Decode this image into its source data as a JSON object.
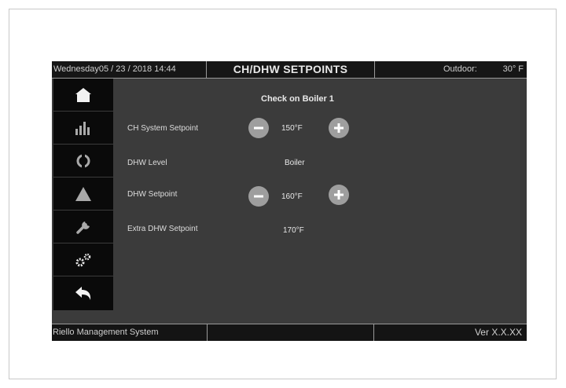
{
  "header": {
    "date_time": "Wednesday05 / 23 / 2018    14:44",
    "title": "CH/DHW SETPOINTS",
    "outdoor_label": "Outdoor:",
    "outdoor_value": "30° F"
  },
  "sidebar": {
    "items": [
      {
        "icon": "home-icon"
      },
      {
        "icon": "bar-chart-icon"
      },
      {
        "icon": "refresh-icon"
      },
      {
        "icon": "warning-icon"
      },
      {
        "icon": "wrench-icon"
      },
      {
        "icon": "gears-icon"
      },
      {
        "icon": "back-arrow-icon"
      }
    ]
  },
  "main": {
    "heading": "Check on Boiler 1",
    "ch_setpoint": {
      "label": "CH System Setpoint",
      "value": "150°F"
    },
    "dhw_level": {
      "label": "DHW Level",
      "value": "Boiler"
    },
    "dhw_setpoint": {
      "label": "DHW Setpoint",
      "value": "160°F"
    },
    "extra_dhw": {
      "label": "Extra DHW Setpoint",
      "value": "170°F"
    }
  },
  "footer": {
    "system_name": "Riello Management System",
    "version": "Ver X.X.XX"
  },
  "colors": {
    "screen_bg": "#3b3b3b",
    "bar_bg": "#161616",
    "nav_bg": "#0a0a0a",
    "stepper_bg": "#9e9e9e"
  }
}
